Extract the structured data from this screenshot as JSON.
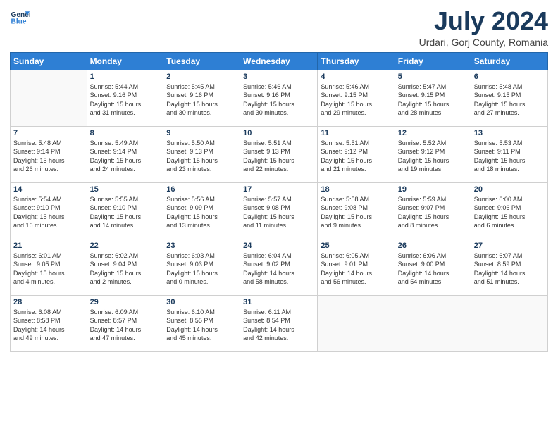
{
  "header": {
    "logo_line1": "General",
    "logo_line2": "Blue",
    "title": "July 2024",
    "subtitle": "Urdari, Gorj County, Romania"
  },
  "weekdays": [
    "Sunday",
    "Monday",
    "Tuesday",
    "Wednesday",
    "Thursday",
    "Friday",
    "Saturday"
  ],
  "weeks": [
    [
      {
        "day": "",
        "info": ""
      },
      {
        "day": "1",
        "info": "Sunrise: 5:44 AM\nSunset: 9:16 PM\nDaylight: 15 hours\nand 31 minutes."
      },
      {
        "day": "2",
        "info": "Sunrise: 5:45 AM\nSunset: 9:16 PM\nDaylight: 15 hours\nand 30 minutes."
      },
      {
        "day": "3",
        "info": "Sunrise: 5:46 AM\nSunset: 9:16 PM\nDaylight: 15 hours\nand 30 minutes."
      },
      {
        "day": "4",
        "info": "Sunrise: 5:46 AM\nSunset: 9:15 PM\nDaylight: 15 hours\nand 29 minutes."
      },
      {
        "day": "5",
        "info": "Sunrise: 5:47 AM\nSunset: 9:15 PM\nDaylight: 15 hours\nand 28 minutes."
      },
      {
        "day": "6",
        "info": "Sunrise: 5:48 AM\nSunset: 9:15 PM\nDaylight: 15 hours\nand 27 minutes."
      }
    ],
    [
      {
        "day": "7",
        "info": "Sunrise: 5:48 AM\nSunset: 9:14 PM\nDaylight: 15 hours\nand 26 minutes."
      },
      {
        "day": "8",
        "info": "Sunrise: 5:49 AM\nSunset: 9:14 PM\nDaylight: 15 hours\nand 24 minutes."
      },
      {
        "day": "9",
        "info": "Sunrise: 5:50 AM\nSunset: 9:13 PM\nDaylight: 15 hours\nand 23 minutes."
      },
      {
        "day": "10",
        "info": "Sunrise: 5:51 AM\nSunset: 9:13 PM\nDaylight: 15 hours\nand 22 minutes."
      },
      {
        "day": "11",
        "info": "Sunrise: 5:51 AM\nSunset: 9:12 PM\nDaylight: 15 hours\nand 21 minutes."
      },
      {
        "day": "12",
        "info": "Sunrise: 5:52 AM\nSunset: 9:12 PM\nDaylight: 15 hours\nand 19 minutes."
      },
      {
        "day": "13",
        "info": "Sunrise: 5:53 AM\nSunset: 9:11 PM\nDaylight: 15 hours\nand 18 minutes."
      }
    ],
    [
      {
        "day": "14",
        "info": "Sunrise: 5:54 AM\nSunset: 9:10 PM\nDaylight: 15 hours\nand 16 minutes."
      },
      {
        "day": "15",
        "info": "Sunrise: 5:55 AM\nSunset: 9:10 PM\nDaylight: 15 hours\nand 14 minutes."
      },
      {
        "day": "16",
        "info": "Sunrise: 5:56 AM\nSunset: 9:09 PM\nDaylight: 15 hours\nand 13 minutes."
      },
      {
        "day": "17",
        "info": "Sunrise: 5:57 AM\nSunset: 9:08 PM\nDaylight: 15 hours\nand 11 minutes."
      },
      {
        "day": "18",
        "info": "Sunrise: 5:58 AM\nSunset: 9:08 PM\nDaylight: 15 hours\nand 9 minutes."
      },
      {
        "day": "19",
        "info": "Sunrise: 5:59 AM\nSunset: 9:07 PM\nDaylight: 15 hours\nand 8 minutes."
      },
      {
        "day": "20",
        "info": "Sunrise: 6:00 AM\nSunset: 9:06 PM\nDaylight: 15 hours\nand 6 minutes."
      }
    ],
    [
      {
        "day": "21",
        "info": "Sunrise: 6:01 AM\nSunset: 9:05 PM\nDaylight: 15 hours\nand 4 minutes."
      },
      {
        "day": "22",
        "info": "Sunrise: 6:02 AM\nSunset: 9:04 PM\nDaylight: 15 hours\nand 2 minutes."
      },
      {
        "day": "23",
        "info": "Sunrise: 6:03 AM\nSunset: 9:03 PM\nDaylight: 15 hours\nand 0 minutes."
      },
      {
        "day": "24",
        "info": "Sunrise: 6:04 AM\nSunset: 9:02 PM\nDaylight: 14 hours\nand 58 minutes."
      },
      {
        "day": "25",
        "info": "Sunrise: 6:05 AM\nSunset: 9:01 PM\nDaylight: 14 hours\nand 56 minutes."
      },
      {
        "day": "26",
        "info": "Sunrise: 6:06 AM\nSunset: 9:00 PM\nDaylight: 14 hours\nand 54 minutes."
      },
      {
        "day": "27",
        "info": "Sunrise: 6:07 AM\nSunset: 8:59 PM\nDaylight: 14 hours\nand 51 minutes."
      }
    ],
    [
      {
        "day": "28",
        "info": "Sunrise: 6:08 AM\nSunset: 8:58 PM\nDaylight: 14 hours\nand 49 minutes."
      },
      {
        "day": "29",
        "info": "Sunrise: 6:09 AM\nSunset: 8:57 PM\nDaylight: 14 hours\nand 47 minutes."
      },
      {
        "day": "30",
        "info": "Sunrise: 6:10 AM\nSunset: 8:55 PM\nDaylight: 14 hours\nand 45 minutes."
      },
      {
        "day": "31",
        "info": "Sunrise: 6:11 AM\nSunset: 8:54 PM\nDaylight: 14 hours\nand 42 minutes."
      },
      {
        "day": "",
        "info": ""
      },
      {
        "day": "",
        "info": ""
      },
      {
        "day": "",
        "info": ""
      }
    ]
  ]
}
